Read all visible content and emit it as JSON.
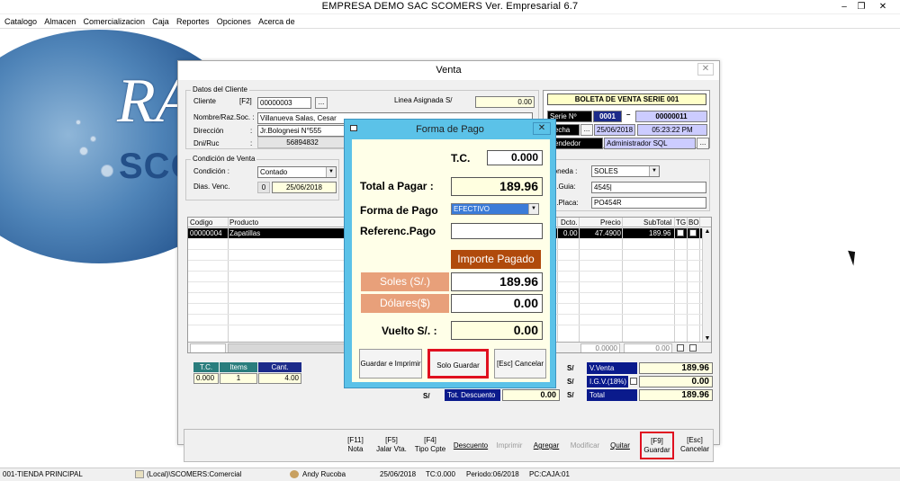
{
  "window": {
    "title": "EMPRESA DEMO SAC       SCOMERS Ver. Empresarial  6.7"
  },
  "menu": [
    "Catalogo",
    "Almacen",
    "Comercializacion",
    "Caja",
    "Reportes",
    "Opciones",
    "Acerca de"
  ],
  "venta": {
    "title": "Venta",
    "cliente": {
      "group": "Datos del Cliente",
      "cliente_label": "Cliente",
      "f2": "[F2]",
      "cliente_code": "00000003",
      "nombre_label": "Nombre/Raz.Soc. :",
      "nombre": "Villanueva  Salas, Cesar",
      "direccion_label": "Dirección",
      "direccion": "Jr.Bolognesi N°555",
      "dni_label": "Dni/Ruc",
      "dni": "56894832",
      "linea_label": "Linea Asignada  S/",
      "linea": "0.00"
    },
    "condicion": {
      "group": "Condición de Venta",
      "condicion_label": "Condición :",
      "condicion": "Contado",
      "dias_label": "Dias. Venc.",
      "dias": "0",
      "fecha": "25/06/2018"
    },
    "boleta": {
      "title": "BOLETA DE VENTA SERIE 001",
      "serie_label": "Serie Nº",
      "serie": "0001",
      "dash": "–",
      "numero": "00000011",
      "fecha_label": "Fecha",
      "fecha": "25/06/2018",
      "hora": "05:23:22 PM",
      "vendedor_label": "Vendedor",
      "vendedor": "Administrador SQL"
    },
    "extra": {
      "moneda_label": "Moneda :",
      "moneda": "SOLES",
      "guia_label": "No.Guia:",
      "guia": "4545|",
      "placa_label": "No.Placa:",
      "placa": "PO454R"
    },
    "grid": {
      "headers": [
        "Codigo",
        "Producto",
        "Dcto.",
        "Precio",
        "SubTotal",
        "TG",
        "BO"
      ],
      "row": {
        "codigo": "00000004",
        "producto": "Zapatillas",
        "dcto": "0.00",
        "precio": "47.4900",
        "subtotal": "189.96"
      },
      "foot_precio": "0.0000",
      "foot_subtotal": "0.00"
    },
    "stats": {
      "tc_label": "T.C.",
      "items_label": "Items",
      "cant_label": "Cant.",
      "tc": "0.000",
      "items": "1",
      "cant": "4.00"
    },
    "totals": {
      "currency": "S/",
      "vventa_label": "V.Venta",
      "vventa": "189.96",
      "igv_label": "I.G.V.(18%)",
      "igv": "0.00",
      "total_label": "Total",
      "total": "189.96",
      "descuento_label": "Tot. Descuento",
      "descuento": "0.00"
    },
    "toolbar": {
      "nota": "[F11]\nNota",
      "jalar": "[F5]\nJalar Vta.",
      "tipo": "[F4]\nTipo Cpte",
      "descuento": "Descuento",
      "imprimir": "Imprimir",
      "agregar": "Agregar",
      "modificar": "Modificar",
      "quitar": "Quitar",
      "guardar": "[F9]\nGuardar",
      "cancelar": "[Esc]\nCancelar"
    }
  },
  "forma_pago": {
    "title": "Forma de Pago",
    "tc_label": "T.C.",
    "tc": "0.000",
    "total_label": "Total a Pagar :",
    "total": "189.96",
    "forma_label": "Forma de Pago",
    "forma": "EFECTIVO",
    "referencia_label": "Referenc.Pago",
    "referencia": "",
    "importe_label": "Importe Pagado",
    "soles_label": "Soles (S/.)",
    "soles": "189.96",
    "dolares_label": "Dólares($)",
    "dolares": "0.00",
    "vuelto_label": "Vuelto S/. :",
    "vuelto": "0.00",
    "btn_imprimir": "Guardar e Imprimir",
    "btn_guardar": "Solo Guardar",
    "btn_cancelar": "[Esc] Cancelar"
  },
  "status": {
    "tienda": "001-TIENDA PRINCIPAL",
    "db": "(Local)\\SCOMERS:Comercial",
    "user": "Andy Rucoba",
    "fecha": "25/06/2018",
    "tc": "TC:0.000",
    "periodo": "Periodo:06/2018",
    "pc": "PC:CAJA:01"
  }
}
